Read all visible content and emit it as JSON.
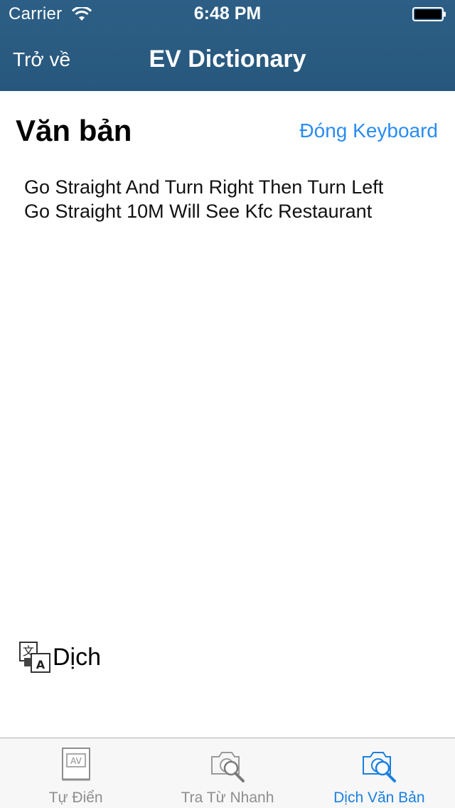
{
  "status_bar": {
    "carrier": "Carrier",
    "time": "6:48 PM"
  },
  "nav": {
    "back_label": "Trở về",
    "title": "EV Dictionary"
  },
  "content": {
    "section_title": "Văn bản",
    "close_keyboard_label": "Đóng Keyboard",
    "input_text": "Go Straight And Turn Right Then Turn Left\nGo Straight 10M Will See Kfc Restaurant",
    "translate_label": "Dịch",
    "translate_icon": "translate-icon"
  },
  "tabs": [
    {
      "label": "Tự Điển",
      "icon": "dictionary-book-icon",
      "active": false
    },
    {
      "label": "Tra Từ Nhanh",
      "icon": "camera-search-icon",
      "active": false
    },
    {
      "label": "Dịch Văn Bản",
      "icon": "camera-search-icon",
      "active": true
    }
  ],
  "colors": {
    "header_bg": "#2b5a7e",
    "accent": "#2a8cf0",
    "tab_active": "#1a7fe0",
    "tab_inactive": "#8e8e8e"
  }
}
